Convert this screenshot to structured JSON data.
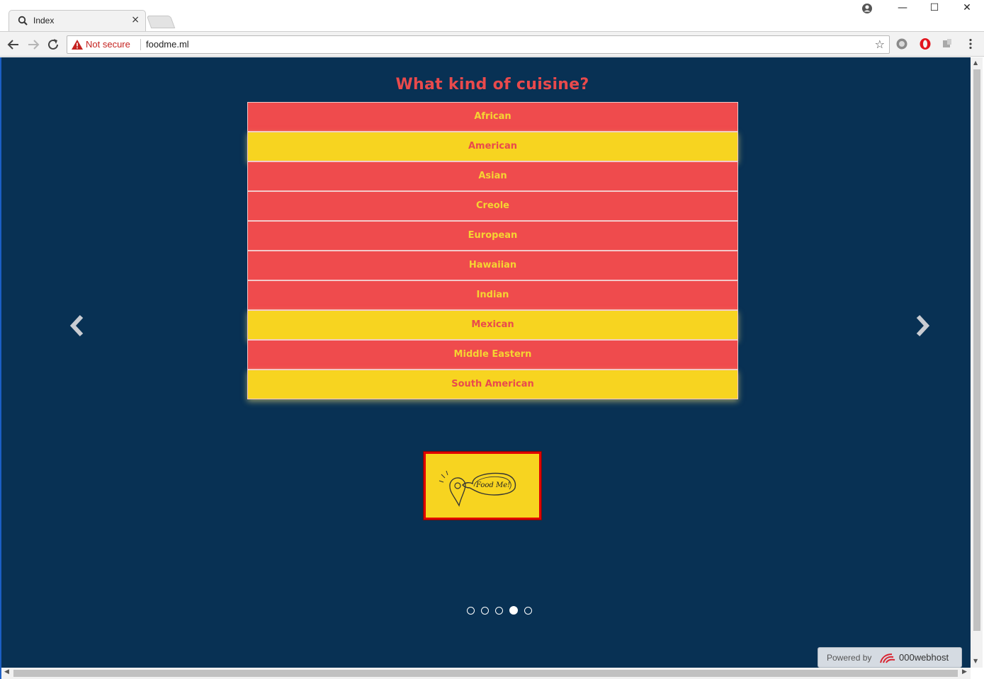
{
  "browser": {
    "tab_title": "Index",
    "tab_close": "×",
    "security_label": "Not secure",
    "url": "foodme.ml",
    "window_buttons": {
      "minimize": "—",
      "maximize": "☐",
      "close": "✕"
    },
    "bookmark_icon": "star-icon"
  },
  "page": {
    "heading": "What kind of cuisine?",
    "options": [
      {
        "label": "African",
        "selected": false
      },
      {
        "label": "American",
        "selected": true
      },
      {
        "label": "Asian",
        "selected": false
      },
      {
        "label": "Creole",
        "selected": false
      },
      {
        "label": "European",
        "selected": false
      },
      {
        "label": "Hawaiian",
        "selected": false
      },
      {
        "label": "Indian",
        "selected": false
      },
      {
        "label": "Mexican",
        "selected": true
      },
      {
        "label": "Middle Eastern",
        "selected": false
      },
      {
        "label": "South American",
        "selected": true
      }
    ],
    "logo_text": "Food Me!",
    "carousel": {
      "slides": 5,
      "active_index": 3
    },
    "powered_by": {
      "label": "Powered by",
      "brand": "000webhost"
    }
  },
  "colors": {
    "background": "#083154",
    "unselected": "#ef4b4d",
    "selected": "#f7d420",
    "heading": "#e94a4c"
  }
}
